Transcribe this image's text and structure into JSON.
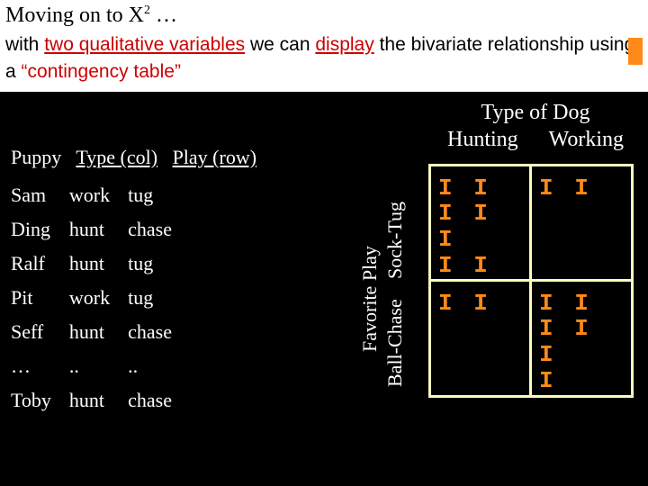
{
  "intro": {
    "line1_a": "Moving on to X",
    "line1_sup": "2",
    "line1_b": " …",
    "para_a": "with ",
    "para_red1": "two qualitative variables",
    "para_b": " we can ",
    "para_red2": "display",
    "para_c": " the bivariate relationship using a ",
    "para_quote": "“contingency table”"
  },
  "header": {
    "puppy": "Puppy",
    "type": "Type (col)",
    "play": "Play (row)"
  },
  "rows": [
    {
      "p": "Sam",
      "t": "work",
      "pl": "tug"
    },
    {
      "p": "Ding",
      "t": "hunt",
      "pl": "chase"
    },
    {
      "p": "Ralf",
      "t": "hunt",
      "pl": "tug"
    },
    {
      "p": "Pit",
      "t": "work",
      "pl": "tug"
    },
    {
      "p": "Seff",
      "t": "hunt",
      "pl": "chase"
    },
    {
      "p": "…",
      "t": "..",
      "pl": ".."
    },
    {
      "p": "Toby",
      "t": "hunt",
      "pl": "chase"
    }
  ],
  "ct": {
    "title": "Type of Dog",
    "col1": "Hunting",
    "col2": "Working",
    "rowaxis": "Favorite Play",
    "row1": "Sock-Tug",
    "row2": "Ball-Chase",
    "cells": {
      "tl_a": "I I I I I",
      "tl_b": "I I",
      "tr": "I I",
      "bl": "I I",
      "br_a": "I I I I I",
      "br_b": "I"
    }
  },
  "chart_data": {
    "type": "table",
    "title": "Type of Dog",
    "row_axis_label": "Favorite Play",
    "columns": [
      "Hunting",
      "Working"
    ],
    "rows": [
      "Sock-Tug",
      "Ball-Chase"
    ],
    "values": [
      [
        7,
        2
      ],
      [
        2,
        6
      ]
    ],
    "note": "values are tally counts read from orange tally marks"
  }
}
